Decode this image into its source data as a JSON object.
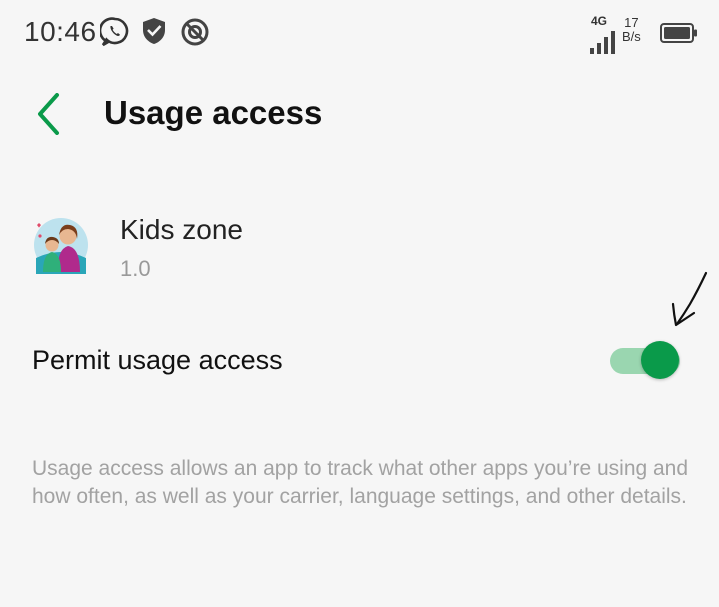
{
  "status_bar": {
    "time": "10:46",
    "network_type": "4G",
    "speed_value": "17",
    "speed_unit": "B/s"
  },
  "header": {
    "title": "Usage access"
  },
  "app": {
    "name": "Kids zone",
    "version": "1.0"
  },
  "permit": {
    "label": "Permit usage access",
    "enabled": true
  },
  "description": "Usage access allows an app to track what other apps you’re using and how often, as well as your carrier, language settings, and other details.",
  "colors": {
    "accent": "#0a9a4a",
    "track": "#9ad6b0",
    "background": "#f6f6f6"
  }
}
